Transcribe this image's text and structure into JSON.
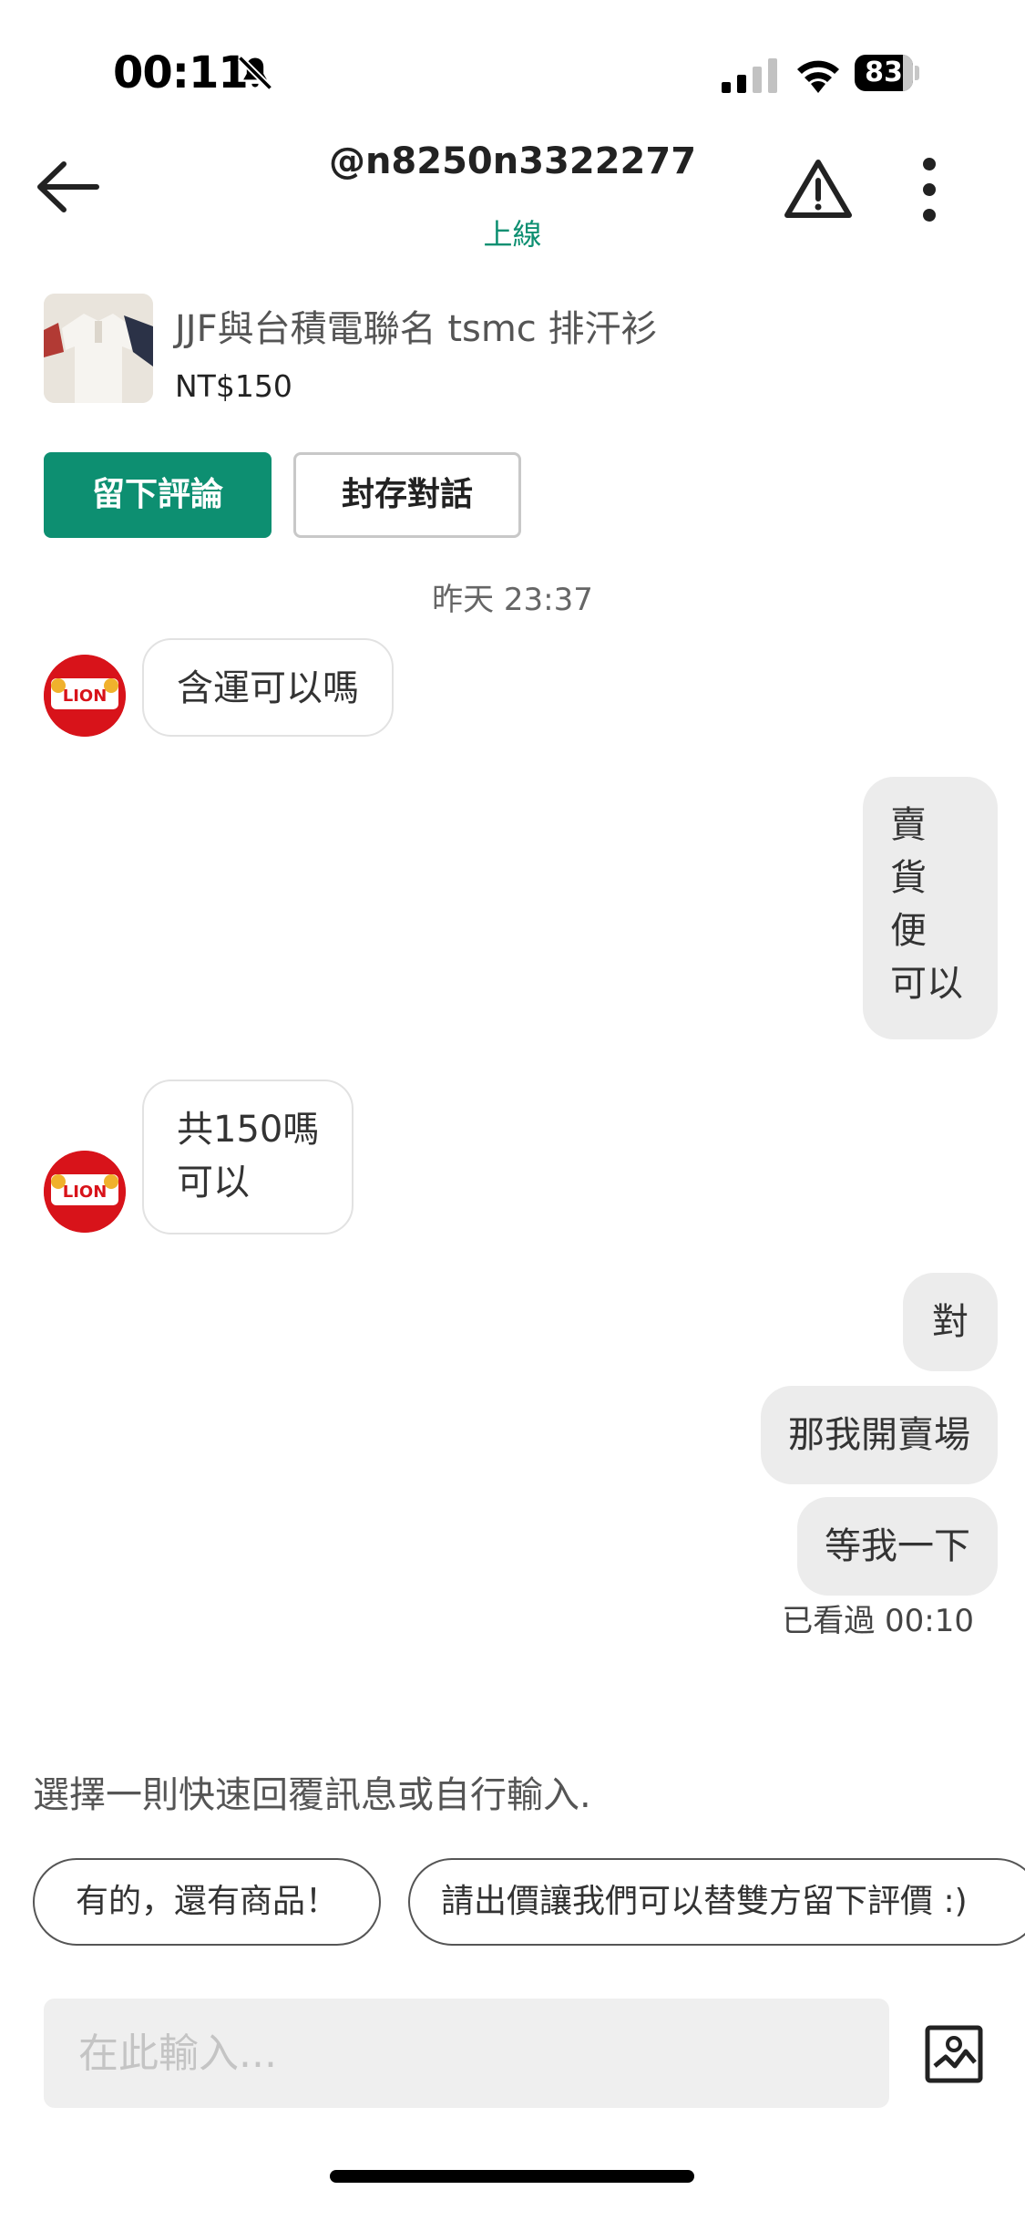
{
  "status_bar": {
    "time": "00:11",
    "battery": "83",
    "battery_level": 0.83
  },
  "header": {
    "title": "@n8250n3322277",
    "status": "上線"
  },
  "product": {
    "name": "JJF與台積電聯名 tsmc 排汗衫",
    "price": "NT$150"
  },
  "actions": {
    "review": "留下評論",
    "archive": "封存對話"
  },
  "chat": {
    "date": "昨天 23:37",
    "messages": [
      {
        "from": "them",
        "lines": [
          "含運可以嗎"
        ]
      },
      {
        "from": "me",
        "lines": [
          "賣",
          "貨",
          "便",
          "可以"
        ]
      },
      {
        "from": "them",
        "lines": [
          "共150嗎",
          "可以"
        ]
      },
      {
        "from": "me",
        "lines": [
          "對"
        ]
      },
      {
        "from": "me",
        "lines": [
          "那我開賣場"
        ]
      },
      {
        "from": "me",
        "lines": [
          "等我一下"
        ]
      }
    ],
    "seen": "已看過 00:10"
  },
  "quick_reply": {
    "hint": "選擇一則快速回覆訊息或自行輸入.",
    "chips": [
      "有的，還有商品！",
      "請出價讓我們可以替雙方留下評價 :)"
    ]
  },
  "input": {
    "placeholder": "在此輸入..."
  },
  "colors": {
    "accent": "#0d8f71",
    "bubble_out": "#ececec",
    "avatar_bg": "#d8131a"
  },
  "icons": [
    "bell-off-icon",
    "cellular-signal-icon",
    "wifi-icon",
    "battery-icon",
    "back-arrow-icon",
    "warning-icon",
    "more-vertical-icon",
    "image-upload-icon"
  ]
}
